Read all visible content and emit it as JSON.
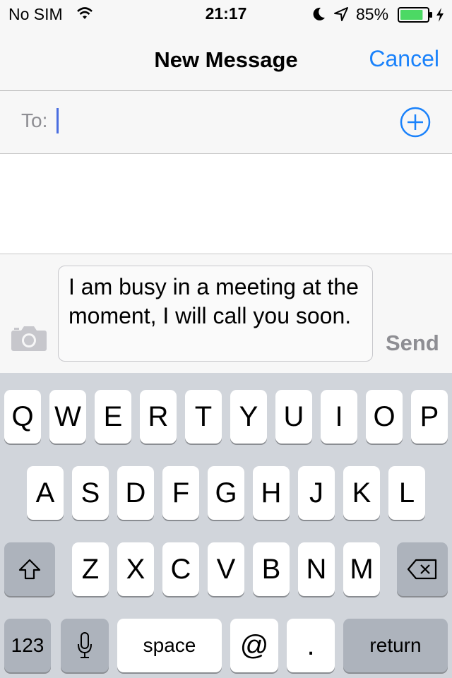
{
  "status_bar": {
    "carrier": "No SIM",
    "time": "21:17",
    "battery_percent": "85%",
    "battery_level": 0.85,
    "icons": [
      "wifi-icon",
      "moon-icon",
      "location-arrow-icon",
      "battery-icon",
      "charging-bolt-icon"
    ]
  },
  "nav": {
    "title": "New Message",
    "cancel_label": "Cancel"
  },
  "recipient": {
    "label": "To:",
    "value": "",
    "add_icon": "plus-circle-icon"
  },
  "compose": {
    "message_text": "I am busy in a meeting at the moment, I will call you soon.",
    "send_label": "Send",
    "camera_icon": "camera-icon"
  },
  "keyboard": {
    "row1": [
      "Q",
      "W",
      "E",
      "R",
      "T",
      "Y",
      "U",
      "I",
      "O",
      "P"
    ],
    "row2": [
      "A",
      "S",
      "D",
      "F",
      "G",
      "H",
      "J",
      "K",
      "L"
    ],
    "row3": [
      "Z",
      "X",
      "C",
      "V",
      "B",
      "N",
      "M"
    ],
    "numbers_label": "123",
    "space_label": "space",
    "at_label": "@",
    "dot_label": ".",
    "return_label": "return",
    "shift_icon": "shift-icon",
    "delete_icon": "backspace-icon",
    "mic_icon": "microphone-icon"
  },
  "colors": {
    "accent": "#1a82fb",
    "keyboard_bg": "#d1d5db",
    "bar_bg": "#f7f7f7",
    "battery_fill": "#4cd964"
  }
}
